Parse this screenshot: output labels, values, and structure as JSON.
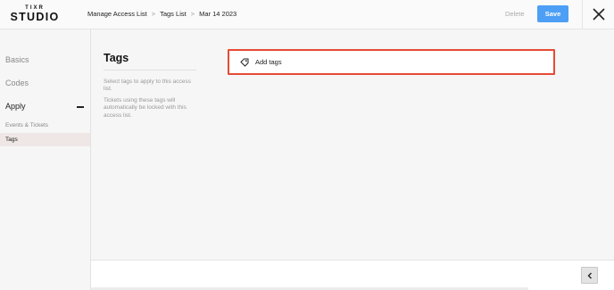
{
  "brand": {
    "top": "TIXR",
    "main": "STUDIO"
  },
  "breadcrumb": [
    "Manage Access List",
    "Tags List",
    "Mar 14 2023"
  ],
  "breadcrumb_separator": ">",
  "header": {
    "delete_label": "Delete",
    "save_label": "Save"
  },
  "sidebar": {
    "items": [
      {
        "label": "Basics"
      },
      {
        "label": "Codes"
      },
      {
        "label": "Apply"
      }
    ],
    "sub_items": [
      {
        "label": "Events & Tickets"
      },
      {
        "label": "Tags",
        "active": true
      }
    ]
  },
  "section": {
    "title": "Tags",
    "description_1": "Select tags to apply to this access list.",
    "description_2": "Tickets using these tags will automatically be locked with this access list."
  },
  "add_tags": {
    "label": "Add tags",
    "icon": "tag-icon"
  },
  "colors": {
    "accent": "#4d9ff5",
    "highlight": "#e54b35",
    "active_bg": "#efe6e6"
  },
  "icons": {
    "close": "close-icon",
    "collapse": "chevron-left-icon",
    "section_toggle": "minus-icon"
  }
}
